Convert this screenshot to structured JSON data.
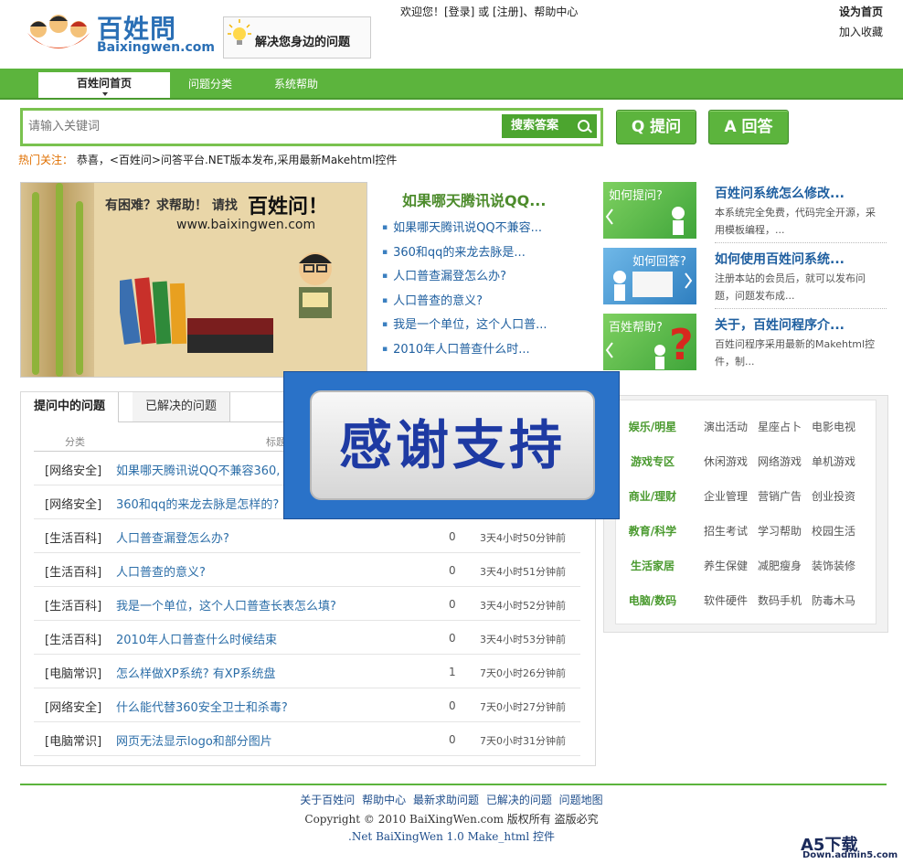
{
  "header": {
    "logo_name": "百姓問",
    "logo_domain": "Baixingwen.com",
    "slogan": "解决您身边的问题",
    "welcome": "欢迎您！[登录] 或 [注册]、帮助中心",
    "set_home": "设为首页",
    "add_fav": "加入收藏"
  },
  "nav": {
    "items": [
      "百姓问首页",
      "问题分类",
      "系统帮助"
    ]
  },
  "search": {
    "placeholder": "请输入关键词",
    "button": "搜索答案",
    "ask": "Q 提问",
    "answer": "A 回答"
  },
  "hot": {
    "label": "热门关注：",
    "text": "恭喜，<百姓问>问答平台.NET版本发布,采用最新Makehtml控件"
  },
  "banner": {
    "t1": "有困难？求帮助！ 请找",
    "t2": "百姓问！",
    "t3": "www.baixingwen.com"
  },
  "headline": {
    "title": "如果哪天腾讯说QQ...",
    "items": [
      "如果哪天腾讯说QQ不兼容...",
      "360和qq的来龙去脉是...",
      "人口普查漏登怎么办?",
      "人口普查的意义?",
      "我是一个单位，这个人口普...",
      "2010年人口普查什么时..."
    ]
  },
  "cards": [
    {
      "thumb": "如何提问?",
      "title": "百姓问系统怎么修改...",
      "desc": "本系统完全免费，代码完全开源，采用模板编程，..."
    },
    {
      "thumb": "如何回答?",
      "title": "如何使用百姓问系统...",
      "desc": "注册本站的会员后，就可以发布问题，问题发布成..."
    },
    {
      "thumb": "百姓帮助?",
      "title": "关于，百姓问程序介...",
      "desc": "百姓问程序采用最新的Makehtml控件，制..."
    }
  ],
  "questions": {
    "tabs": [
      "提问中的问题",
      "已解决的问题"
    ],
    "col_cat": "分类",
    "col_title": "标题",
    "rows": [
      {
        "cat": "[网络安全]",
        "title": "如果哪天腾讯说QQ不兼容360,",
        "count": "",
        "time": ""
      },
      {
        "cat": "[网络安全]",
        "title": "360和qq的来龙去脉是怎样的?",
        "count": "",
        "time": ""
      },
      {
        "cat": "[生活百科]",
        "title": "人口普查漏登怎么办?",
        "count": "0",
        "time": "3天4小时50分钟前"
      },
      {
        "cat": "[生活百科]",
        "title": "人口普查的意义?",
        "count": "0",
        "time": "3天4小时51分钟前"
      },
      {
        "cat": "[生活百科]",
        "title": "我是一个单位，这个人口普查长表怎么填?",
        "count": "0",
        "time": "3天4小时52分钟前"
      },
      {
        "cat": "[生活百科]",
        "title": "2010年人口普查什么时候结束",
        "count": "0",
        "time": "3天4小时53分钟前"
      },
      {
        "cat": "[电脑常识]",
        "title": "怎么样做XP系统?  有XP系统盘",
        "count": "1",
        "time": "7天0小时26分钟前"
      },
      {
        "cat": "[网络安全]",
        "title": "什么能代替360安全卫士和杀毒?",
        "count": "0",
        "time": "7天0小时27分钟前"
      },
      {
        "cat": "[电脑常识]",
        "title": "网页无法显示logo和部分图片",
        "count": "0",
        "time": "7天0小时31分钟前"
      }
    ]
  },
  "overlay": {
    "text": "感谢支持"
  },
  "categories": [
    {
      "head": "娱乐/明星",
      "subs": [
        "演出活动",
        "星座占卜",
        "电影电视"
      ]
    },
    {
      "head": "游戏专区",
      "subs": [
        "休闲游戏",
        "网络游戏",
        "单机游戏"
      ]
    },
    {
      "head": "商业/理财",
      "subs": [
        "企业管理",
        "营销广告",
        "创业投资"
      ]
    },
    {
      "head": "教育/科学",
      "subs": [
        "招生考试",
        "学习帮助",
        "校园生活"
      ]
    },
    {
      "head": "生活家居",
      "subs": [
        "养生保健",
        "减肥瘦身",
        "装饰装修"
      ]
    },
    {
      "head": "电脑/数码",
      "subs": [
        "软件硬件",
        "数码手机",
        "防毒木马"
      ]
    }
  ],
  "footer": {
    "links": [
      "关于百姓问",
      "帮助中心",
      "最新求助问题",
      "已解决的问题",
      "问题地图"
    ],
    "copyright": "Copyright © 2010 BaiXingWen.com 版权所有  盗版必究",
    "version": ".Net BaiXingWen 1.0 Make_html 控件",
    "watermark_top": "A5下载",
    "watermark_bottom": "Down.admin5.com"
  },
  "colors": {
    "brand_green": "#5cb43d",
    "link_blue": "#2c6ea8",
    "overlay_blue": "#2a72c8"
  }
}
